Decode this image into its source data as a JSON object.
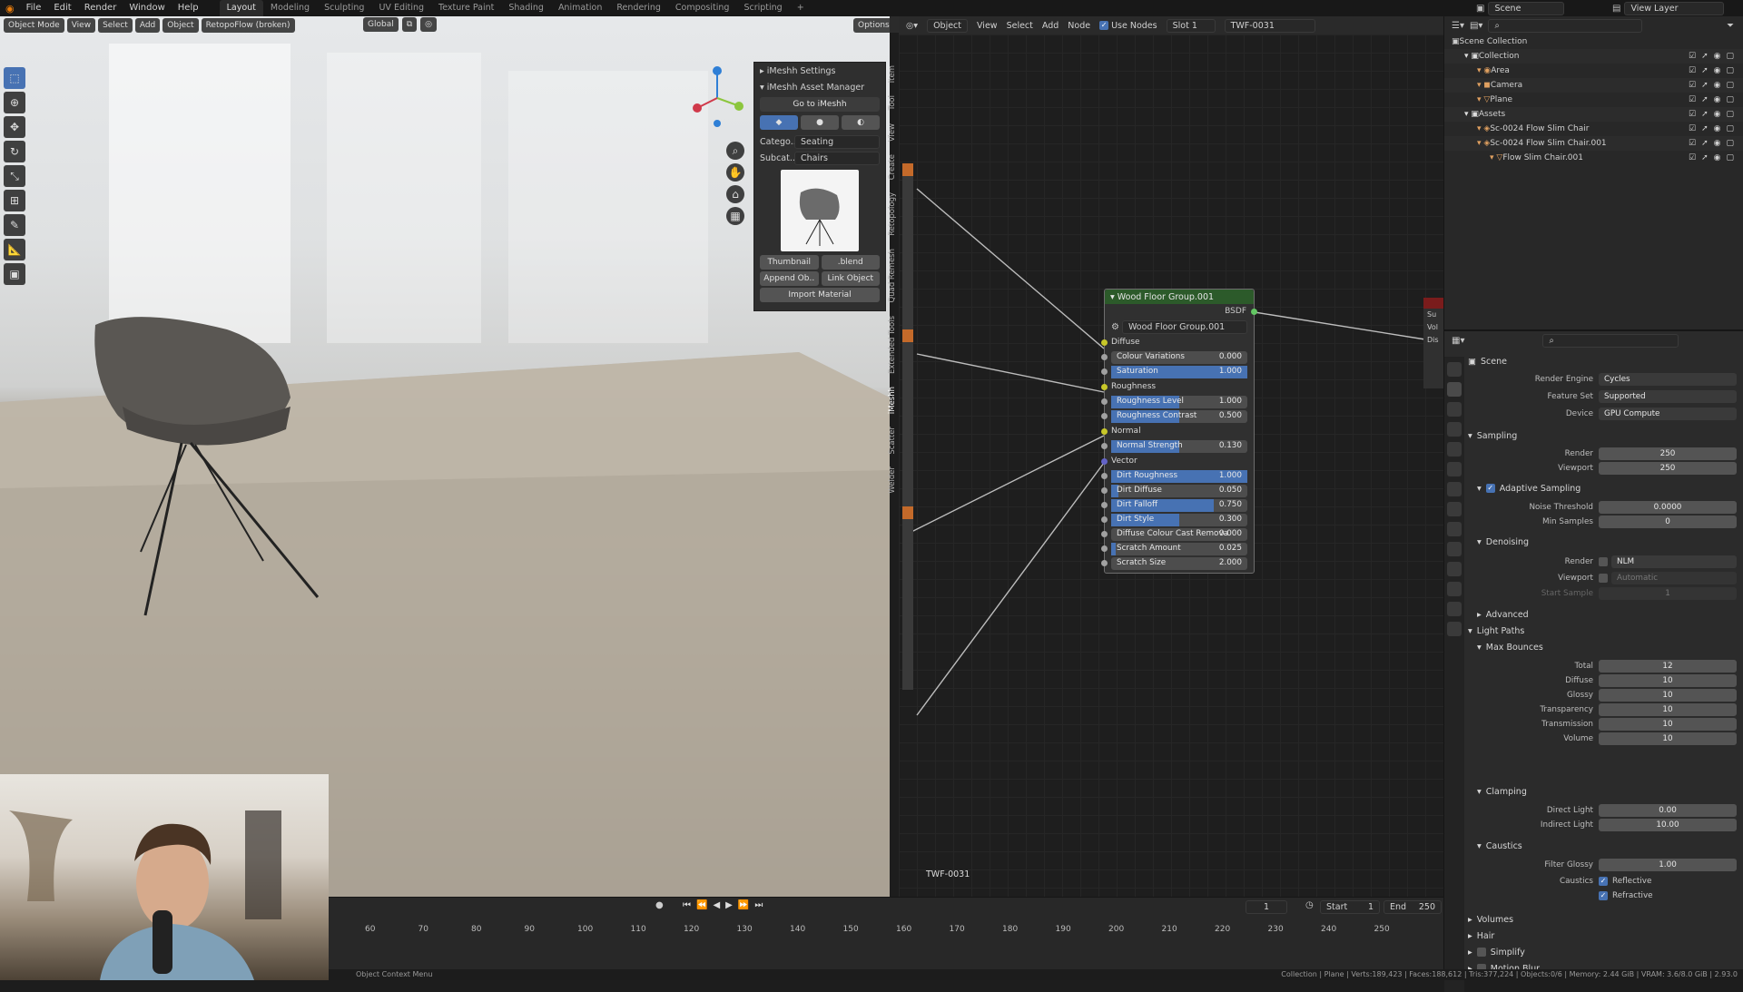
{
  "topbar": {
    "menus": [
      "File",
      "Edit",
      "Render",
      "Window",
      "Help"
    ],
    "workspaces": [
      "Layout",
      "Modeling",
      "Sculpting",
      "UV Editing",
      "Texture Paint",
      "Shading",
      "Animation",
      "Rendering",
      "Compositing",
      "Scripting"
    ],
    "active_workspace": "Layout",
    "scene_label": "Scene",
    "view_layer_label": "View Layer"
  },
  "viewport": {
    "mode": "Object Mode",
    "menus": [
      "View",
      "Select",
      "Add",
      "Object"
    ],
    "addon_button": "RetopoFlow (broken)",
    "transform_orientation": "Global",
    "options_label": "Options",
    "tools": [
      "select-box",
      "cursor",
      "move",
      "rotate",
      "scale",
      "transform",
      "annotate",
      "measure",
      "add-cube"
    ]
  },
  "npanel": {
    "settings_header": "iMeshh Settings",
    "manager_header": "iMeshh Asset Manager",
    "goto_button": "Go to iMeshh",
    "category_label": "Catego..",
    "category_value": "Seating",
    "subcategory_label": "Subcat..",
    "subcategory_value": "Chairs",
    "thumbnail_button": "Thumbnail",
    "blend_button": ".blend",
    "append_button": "Append Ob..",
    "link_button": "Link Object",
    "import_material_button": "Import Material",
    "side_tabs": [
      "Item",
      "Tool",
      "View",
      "Create",
      "Retopology",
      "Quad Remesh",
      "Extended Tools",
      "iMeshh",
      "Scatter",
      "Welder"
    ]
  },
  "node_editor": {
    "header": {
      "object_label": "Object",
      "menus": [
        "View",
        "Select",
        "Add",
        "Node"
      ],
      "use_nodes_label": "Use Nodes",
      "slot_label": "Slot 1",
      "material_name": "TWF-0031"
    },
    "footer_material": "TWF-0031",
    "right_partial_labels": [
      "Su",
      "Vol",
      "Dis"
    ],
    "node": {
      "title": "Wood Floor Group.001",
      "output_label": "BSDF",
      "group_name": "Wood Floor Group.001",
      "sections": [
        "Diffuse",
        "Roughness",
        "Normal",
        "Vector"
      ],
      "diffuse_sliders": [
        {
          "label": "Colour Variations",
          "value": "0.000",
          "fill": 0
        },
        {
          "label": "Saturation",
          "value": "1.000",
          "fill": 1
        }
      ],
      "roughness_sliders": [
        {
          "label": "Roughness Level",
          "value": "1.000",
          "fill": 0.5
        },
        {
          "label": "Roughness Contrast",
          "value": "0.500",
          "fill": 0.5
        }
      ],
      "normal_sliders": [
        {
          "label": "Normal Strength",
          "value": "0.130",
          "fill": 0.5
        }
      ],
      "vector_sliders": [
        {
          "label": "Dirt Roughness",
          "value": "1.000",
          "fill": 1
        },
        {
          "label": "Dirt Diffuse",
          "value": "0.050",
          "fill": 0.05
        },
        {
          "label": "Dirt Falloff",
          "value": "0.750",
          "fill": 0.75
        },
        {
          "label": "Dirt Style",
          "value": "0.300",
          "fill": 0.5
        },
        {
          "label": "Diffuse Colour Cast Remova",
          "value": "0.000",
          "fill": 0
        },
        {
          "label": "Scratch Amount",
          "value": "0.025",
          "fill": 0.03
        },
        {
          "label": "Scratch Size",
          "value": "2.000",
          "fill": 0
        }
      ]
    }
  },
  "outliner": {
    "rows": [
      {
        "label": "Scene Collection",
        "indent": 0
      },
      {
        "label": "Collection",
        "indent": 1
      },
      {
        "label": "Area",
        "indent": 2
      },
      {
        "label": "Camera",
        "indent": 2
      },
      {
        "label": "Plane",
        "indent": 2
      },
      {
        "label": "Assets",
        "indent": 1
      },
      {
        "label": "Sc-0024 Flow Slim Chair",
        "indent": 2
      },
      {
        "label": "Sc-0024 Flow Slim Chair.001",
        "indent": 2
      },
      {
        "label": "Flow Slim Chair.001",
        "indent": 3
      }
    ]
  },
  "properties": {
    "context": "Scene",
    "render_engine_label": "Render Engine",
    "render_engine": "Cycles",
    "feature_set_label": "Feature Set",
    "feature_set": "Supported",
    "device_label": "Device",
    "device": "GPU Compute",
    "sampling": {
      "header": "Sampling",
      "render_label": "Render",
      "render": "250",
      "viewport_label": "Viewport",
      "viewport": "250",
      "adaptive_label": "Adaptive Sampling",
      "noise_label": "Noise Threshold",
      "noise": "0.0000",
      "min_samples_label": "Min Samples",
      "min_samples": "0"
    },
    "denoising": {
      "header": "Denoising",
      "render_label": "Render",
      "render": "NLM",
      "viewport_label": "Viewport",
      "viewport": "Automatic",
      "start_sample_label": "Start Sample",
      "start_sample": "1"
    },
    "advanced_header": "Advanced",
    "light_paths": {
      "header": "Light Paths",
      "max_bounces_header": "Max Bounces",
      "bounces": [
        {
          "label": "Total",
          "value": "12"
        },
        {
          "label": "Diffuse",
          "value": "10"
        },
        {
          "label": "Glossy",
          "value": "10"
        },
        {
          "label": "Transparency",
          "value": "10"
        },
        {
          "label": "Transmission",
          "value": "10"
        },
        {
          "label": "Volume",
          "value": "10"
        }
      ]
    },
    "clamping": {
      "header": "Clamping",
      "direct_label": "Direct Light",
      "direct": "0.00",
      "indirect_label": "Indirect Light",
      "indirect": "10.00"
    },
    "caustics": {
      "header": "Caustics",
      "filter_label": "Filter Glossy",
      "filter": "1.00",
      "caustics_label": "Caustics",
      "reflective_label": "Reflective",
      "refractive_label": "Refractive"
    },
    "collapsed_sections": [
      "Volumes",
      "Hair",
      "Simplify",
      "Motion Blur"
    ]
  },
  "timeline": {
    "current_frame": "1",
    "start_label": "Start",
    "start": "1",
    "end_label": "End",
    "end": "250",
    "ticks": [
      "60",
      "70",
      "80",
      "90",
      "100",
      "110",
      "120",
      "130",
      "140",
      "150",
      "160",
      "170",
      "180",
      "190",
      "200",
      "210",
      "220",
      "230",
      "240",
      "250"
    ]
  },
  "statusbar": {
    "left": "Object Context Menu",
    "right": "Collection | Plane | Verts:189,423 | Faces:188,612 | Tris:377,224 | Objects:0/6 | Memory: 2.44 GiB | VRAM: 3.6/8.0 GiB | 2.93.0"
  },
  "colors": {
    "accent": "#4772b3",
    "node_header": "#2c5a2a",
    "panel_bg": "#2b2b2b"
  }
}
